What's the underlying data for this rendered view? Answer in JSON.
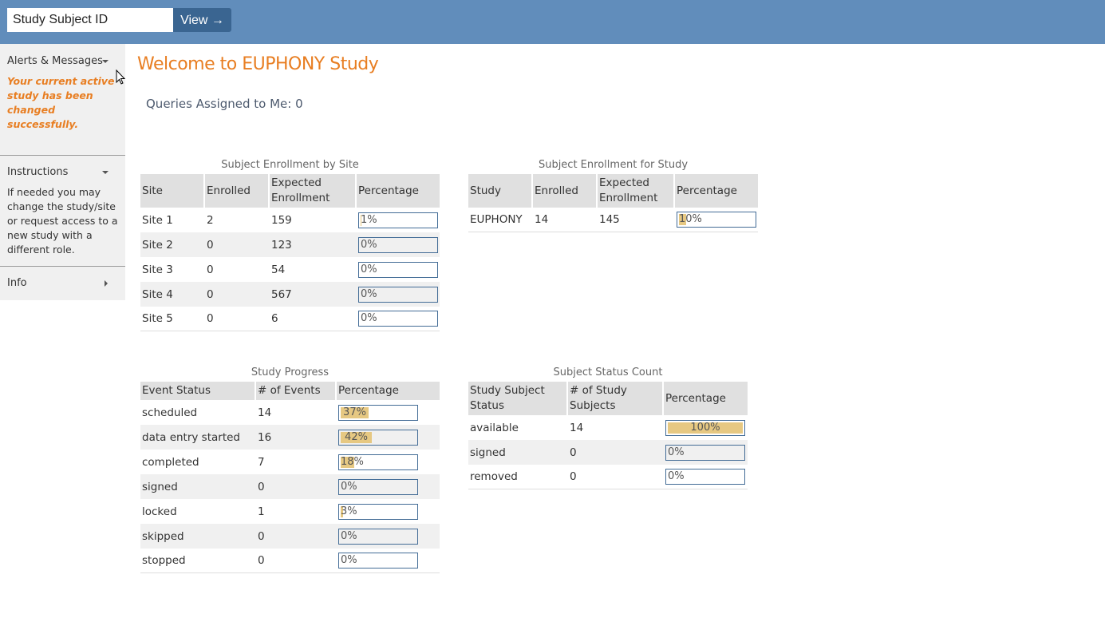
{
  "header": {
    "search_placeholder": "Study Subject ID",
    "search_value": "Study Subject ID",
    "view_button": "View →"
  },
  "sidebar": {
    "alerts": {
      "title": "Alerts & Messages",
      "message": "Your current active study has been changed successfully."
    },
    "instructions": {
      "title": "Instructions",
      "text": "If needed you may change the study/site or request access to a new study with a different role."
    },
    "info": {
      "title": "Info"
    }
  },
  "main": {
    "welcome": "Welcome to EUPHONY Study",
    "queries": "Queries Assigned to Me: 0"
  },
  "tables": {
    "by_site": {
      "caption": "Subject Enrollment by Site",
      "headers": [
        "Site",
        "Enrolled",
        "Expected Enrollment",
        "Percentage"
      ],
      "rows": [
        [
          "Site 1",
          "2",
          "159",
          "1%",
          1
        ],
        [
          "Site 2",
          "0",
          "123",
          "0%",
          0
        ],
        [
          "Site 3",
          "0",
          "54",
          "0%",
          0
        ],
        [
          "Site 4",
          "0",
          "567",
          "0%",
          0
        ],
        [
          "Site 5",
          "0",
          "6",
          "0%",
          0
        ]
      ]
    },
    "for_study": {
      "caption": "Subject Enrollment for Study",
      "headers": [
        "Study",
        "Enrolled",
        "Expected Enrollment",
        "Percentage"
      ],
      "rows": [
        [
          "EUPHONY",
          "14",
          "145",
          "10%",
          10
        ]
      ]
    },
    "progress": {
      "caption": "Study Progress",
      "headers": [
        "Event Status",
        "# of Events",
        "Percentage"
      ],
      "rows": [
        [
          "scheduled",
          "14",
          "37%",
          37
        ],
        [
          "data entry started",
          "16",
          "42%",
          42
        ],
        [
          "completed",
          "7",
          "18%",
          18
        ],
        [
          "signed",
          "0",
          "0%",
          0
        ],
        [
          "locked",
          "1",
          "3%",
          3
        ],
        [
          "skipped",
          "0",
          "0%",
          0
        ],
        [
          "stopped",
          "0",
          "0%",
          0
        ]
      ]
    },
    "status_count": {
      "caption": "Subject Status Count",
      "headers": [
        "Study Subject Status",
        "# of Study Subjects",
        "Percentage"
      ],
      "rows": [
        [
          "available",
          "14",
          "100%",
          100
        ],
        [
          "signed",
          "0",
          "0%",
          0
        ],
        [
          "removed",
          "0",
          "0%",
          0
        ]
      ]
    }
  }
}
